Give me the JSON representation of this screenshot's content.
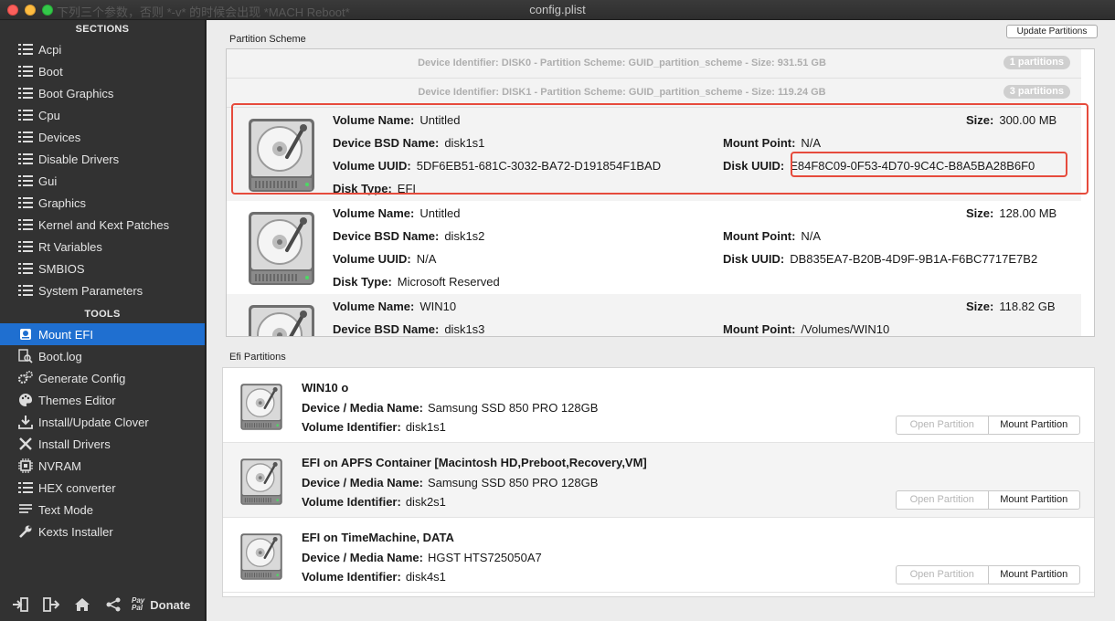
{
  "window": {
    "title": "config.plist",
    "ghost_title": "下列三个参数，否则 *-v* 的时候会出现 *MACH Reboot*"
  },
  "sidebar": {
    "sections_heading": "SECTIONS",
    "sections": [
      {
        "label": "Acpi",
        "icon": "list-icon"
      },
      {
        "label": "Boot",
        "icon": "list-icon"
      },
      {
        "label": "Boot Graphics",
        "icon": "list-icon"
      },
      {
        "label": "Cpu",
        "icon": "list-icon"
      },
      {
        "label": "Devices",
        "icon": "list-icon"
      },
      {
        "label": "Disable Drivers",
        "icon": "list-icon"
      },
      {
        "label": "Gui",
        "icon": "list-icon"
      },
      {
        "label": "Graphics",
        "icon": "list-icon"
      },
      {
        "label": "Kernel and Kext Patches",
        "icon": "list-icon"
      },
      {
        "label": "Rt Variables",
        "icon": "list-icon"
      },
      {
        "label": "SMBIOS",
        "icon": "list-icon"
      },
      {
        "label": "System Parameters",
        "icon": "list-icon"
      }
    ],
    "tools_heading": "TOOLS",
    "tools": [
      {
        "label": "Mount EFI",
        "icon": "disk-icon",
        "active": true
      },
      {
        "label": "Boot.log",
        "icon": "log-search-icon"
      },
      {
        "label": "Generate Config",
        "icon": "gears-icon"
      },
      {
        "label": "Themes Editor",
        "icon": "palette-icon"
      },
      {
        "label": "Install/Update Clover",
        "icon": "download-icon"
      },
      {
        "label": "Install Drivers",
        "icon": "tools-icon"
      },
      {
        "label": "NVRAM",
        "icon": "chip-icon"
      },
      {
        "label": "HEX converter",
        "icon": "list-icon"
      },
      {
        "label": "Text Mode",
        "icon": "text-icon"
      },
      {
        "label": "Kexts Installer",
        "icon": "wrench-icon"
      }
    ],
    "bottom": {
      "donate_label": "Donate",
      "paypal_top": "Pay",
      "paypal_bottom": "Pal"
    }
  },
  "partition_scheme": {
    "label": "Partition Scheme",
    "update_button": "Update Partitions",
    "disks": [
      {
        "text": "Device Identifier: DISK0 - Partition Scheme: GUID_partition_scheme - Size: 931.51 GB",
        "badge": "1 partitions"
      },
      {
        "text": "Device Identifier: DISK1 - Partition Scheme: GUID_partition_scheme - Size: 119.24 GB",
        "badge": "3 partitions"
      }
    ],
    "labels": {
      "volume_name": "Volume Name:",
      "bsd_name": "Device BSD Name:",
      "volume_uuid": "Volume UUID:",
      "disk_type": "Disk Type:",
      "size": "Size:",
      "mount_point": "Mount Point:",
      "disk_uuid": "Disk UUID:"
    },
    "volumes": [
      {
        "volume_name": "Untitled",
        "bsd_name": "disk1s1",
        "volume_uuid": "5DF6EB51-681C-3032-BA72-D191854F1BAD",
        "disk_type": "EFI",
        "size": "300.00 MB",
        "mount_point": "N/A",
        "disk_uuid": "E84F8C09-0F53-4D70-9C4C-B8A5BA28B6F0"
      },
      {
        "volume_name": "Untitled",
        "bsd_name": "disk1s2",
        "volume_uuid": "N/A",
        "disk_type": "Microsoft Reserved",
        "size": "128.00 MB",
        "mount_point": "N/A",
        "disk_uuid": "DB835EA7-B20B-4D9F-9B1A-F6BC7717E7B2"
      },
      {
        "volume_name": "WIN10",
        "bsd_name": "disk1s3",
        "size": "118.82 GB",
        "mount_point": "/Volumes/WIN10"
      }
    ]
  },
  "efi_partitions": {
    "label": "Efi Partitions",
    "labels": {
      "device_media": "Device / Media Name:",
      "volume_identifier": "Volume Identifier:"
    },
    "open_button": "Open Partition",
    "mount_button": "Mount Partition",
    "items": [
      {
        "title": "WIN10 o",
        "device_media": "Samsung SSD 850 PRO 128GB",
        "volume_identifier": "disk1s1"
      },
      {
        "title": "EFI on APFS Container [Macintosh HD,Preboot,Recovery,VM]",
        "device_media": "Samsung SSD 850 PRO 128GB",
        "volume_identifier": "disk2s1"
      },
      {
        "title": "EFI on TimeMachine, DATA",
        "device_media": "HGST HTS725050A7",
        "volume_identifier": "disk4s1"
      }
    ]
  },
  "colors": {
    "accent": "#1f6fd0",
    "highlight": "#e64b3c",
    "sidebar_bg": "#323232"
  }
}
